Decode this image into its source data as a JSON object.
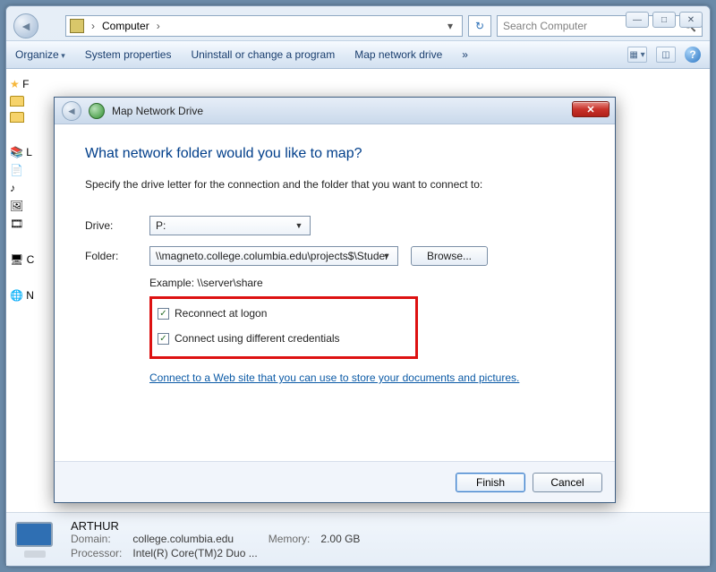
{
  "window": {
    "minimize": "—",
    "maximize": "□",
    "close": "✕"
  },
  "address": {
    "root_icon": "computer",
    "crumb1": "Computer",
    "sep": "›"
  },
  "search": {
    "placeholder": "Search Computer",
    "icon": "🔍"
  },
  "toolbar": {
    "organize": "Organize",
    "sysprops": "System properties",
    "uninstall": "Uninstall or change a program",
    "mapdrive": "Map network drive",
    "more": "»"
  },
  "sidebar": {
    "fav": "F",
    "lib": "L",
    "comp": "C",
    "net": "N"
  },
  "details": {
    "name": "ARTHUR",
    "domain_k": "Domain:",
    "domain_v": "college.columbia.edu",
    "mem_k": "Memory:",
    "mem_v": "2.00 GB",
    "proc_k": "Processor:",
    "proc_v": "Intel(R) Core(TM)2 Duo ..."
  },
  "dialog": {
    "title": "Map Network Drive",
    "heading": "What network folder would you like to map?",
    "sub": "Specify the drive letter for the connection and the folder that you want to connect to:",
    "drive_label": "Drive:",
    "drive_value": "P:",
    "folder_label": "Folder:",
    "folder_value": "\\\\magneto.college.columbia.edu\\projects$\\Studer",
    "browse": "Browse...",
    "example": "Example: \\\\server\\share",
    "chk1": "Reconnect at logon",
    "chk2": "Connect using different credentials",
    "link": "Connect to a Web site that you can use to store your documents and pictures",
    "finish": "Finish",
    "cancel": "Cancel",
    "close": "✕"
  }
}
